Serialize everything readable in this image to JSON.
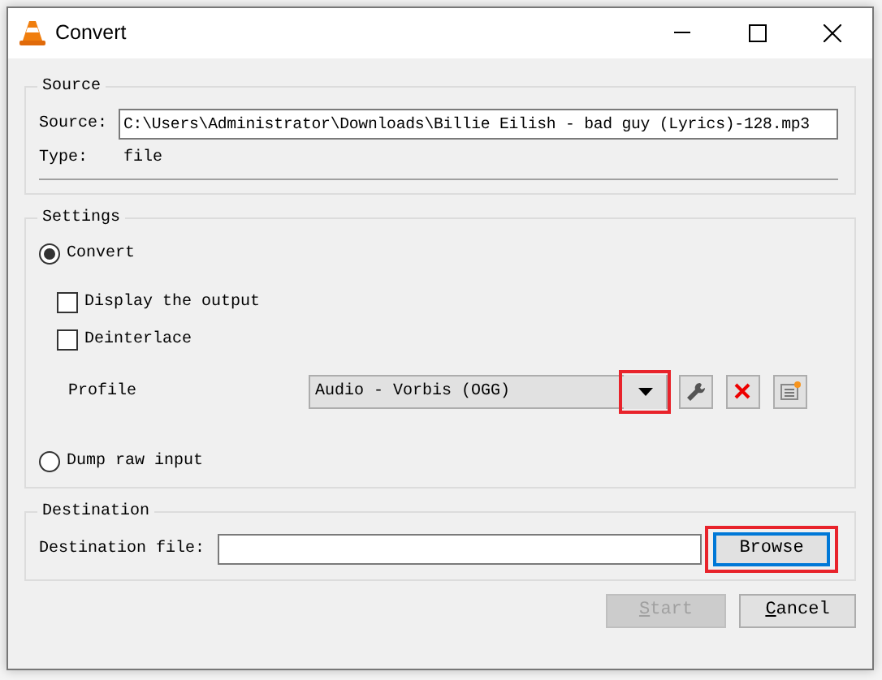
{
  "window": {
    "title": "Convert"
  },
  "source": {
    "legend": "Source",
    "source_label": "Source:",
    "source_value": "C:\\Users\\Administrator\\Downloads\\Billie Eilish - bad guy (Lyrics)-128.mp3",
    "type_label": "Type:",
    "type_value": "file"
  },
  "settings": {
    "legend": "Settings",
    "modes": [
      {
        "label": "Convert",
        "selected": true
      },
      {
        "label": "Dump raw input",
        "selected": false
      }
    ],
    "options": [
      {
        "label": "Display the output",
        "checked": false
      },
      {
        "label": "Deinterlace",
        "checked": false
      }
    ],
    "profile": {
      "label": "Profile",
      "value": "Audio - Vorbis (OGG)",
      "dropdown_highlighted": true
    }
  },
  "destination": {
    "legend": "Destination",
    "file_label": "Destination file:",
    "browse": {
      "label": "Browse",
      "highlighted": true,
      "focused": true
    }
  },
  "buttons": [
    {
      "access_key": "S",
      "label_rest": "tart",
      "disabled": true
    },
    {
      "access_key": "C",
      "label_rest": "ancel",
      "disabled": false
    }
  ]
}
